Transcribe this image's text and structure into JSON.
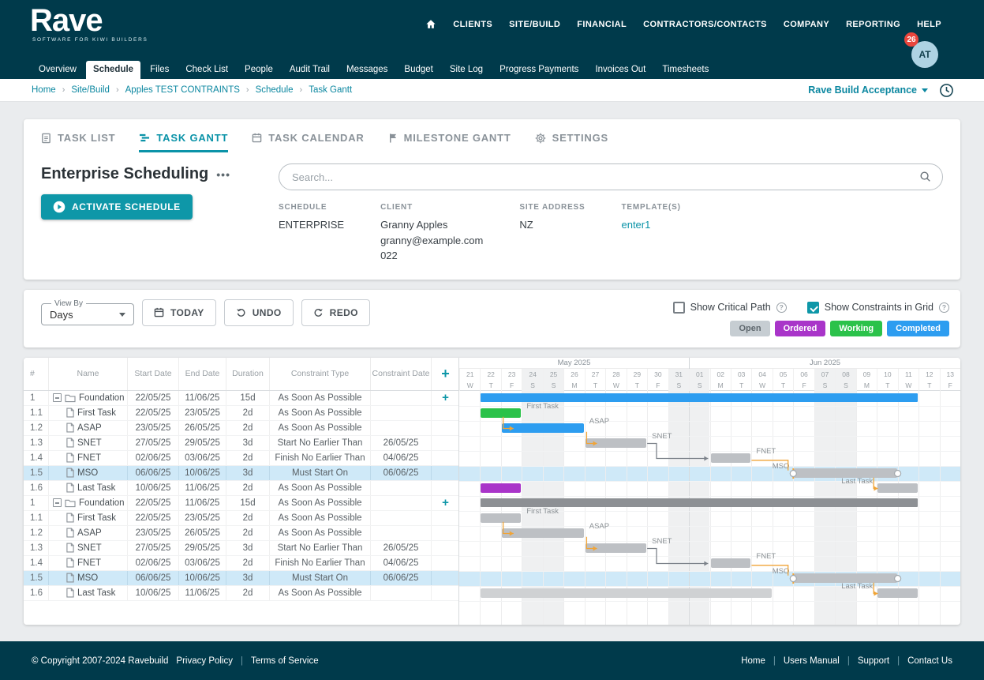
{
  "brand": {
    "name": "Rave",
    "tagline": "SOFTWARE FOR KIWI BUILDERS"
  },
  "topnav": {
    "items": [
      "CLIENTS",
      "SITE/BUILD",
      "FINANCIAL",
      "CONTRACTORS/CONTACTS",
      "COMPANY",
      "REPORTING",
      "HELP"
    ],
    "active": "SITE/BUILD",
    "badge": "26",
    "avatar": "AT"
  },
  "subnav": {
    "items": [
      "Overview",
      "Schedule",
      "Files",
      "Check List",
      "People",
      "Audit Trail",
      "Messages",
      "Budget",
      "Site Log",
      "Progress Payments",
      "Invoices Out",
      "Timesheets"
    ],
    "active": "Schedule"
  },
  "breadcrumb": {
    "items": [
      "Home",
      "Site/Build",
      "Apples TEST CONTRAINTS",
      "Schedule",
      "Task Gantt"
    ],
    "env": "Rave Build Acceptance"
  },
  "view_tabs": [
    {
      "label": "TASK LIST",
      "icon": "doc"
    },
    {
      "label": "TASK GANTT",
      "icon": "gantt",
      "active": true
    },
    {
      "label": "TASK CALENDAR",
      "icon": "calendar"
    },
    {
      "label": "MILESTONE GANTT",
      "icon": "flag"
    },
    {
      "label": "SETTINGS",
      "icon": "gear"
    }
  ],
  "schedule": {
    "title": "Enterprise Scheduling",
    "activate_label": "ACTIVATE SCHEDULE",
    "search_placeholder": "Search...",
    "meta": [
      {
        "label": "SCHEDULE",
        "lines": [
          "ENTERPRISE"
        ]
      },
      {
        "label": "CLIENT",
        "lines": [
          "Granny Apples",
          "granny@example.com",
          "022"
        ]
      },
      {
        "label": "SITE ADDRESS",
        "lines": [
          "NZ"
        ]
      },
      {
        "label": "TEMPLATE(S)",
        "lines": [
          "enter1"
        ],
        "link": true
      }
    ]
  },
  "toolbar": {
    "view_by_label": "View By",
    "view_by_value": "Days",
    "buttons": [
      {
        "label": "TODAY",
        "icon": "calendar"
      },
      {
        "label": "UNDO",
        "icon": "undo"
      },
      {
        "label": "REDO",
        "icon": "redo"
      }
    ],
    "checkboxes": [
      {
        "label": "Show Critical Path",
        "checked": false
      },
      {
        "label": "Show Constraints in Grid",
        "checked": true
      }
    ],
    "legend": [
      {
        "label": "Open",
        "color": "#c6cdd2"
      },
      {
        "label": "Ordered",
        "color": "#a935c9"
      },
      {
        "label": "Working",
        "color": "#2bc24a"
      },
      {
        "label": "Completed",
        "color": "#2d9df0"
      }
    ]
  },
  "grid": {
    "columns": [
      "#",
      "Name",
      "Start Date",
      "End Date",
      "Duration",
      "Constraint Type",
      "Constraint Date"
    ],
    "rows": [
      {
        "num": "1",
        "name": "Foundation",
        "group": true,
        "start": "22/05/25",
        "end": "11/06/25",
        "dur": "15d",
        "ctype": "As Soon As Possible",
        "cdate": "",
        "add": true
      },
      {
        "num": "1.1",
        "name": "First Task",
        "start": "22/05/25",
        "end": "23/05/25",
        "dur": "2d",
        "ctype": "As Soon As Possible",
        "cdate": ""
      },
      {
        "num": "1.2",
        "name": "ASAP",
        "start": "23/05/25",
        "end": "26/05/25",
        "dur": "2d",
        "ctype": "As Soon As Possible",
        "cdate": ""
      },
      {
        "num": "1.3",
        "name": "SNET",
        "start": "27/05/25",
        "end": "29/05/25",
        "dur": "3d",
        "ctype": "Start No Earlier Than",
        "cdate": "26/05/25"
      },
      {
        "num": "1.4",
        "name": "FNET",
        "start": "02/06/25",
        "end": "03/06/25",
        "dur": "2d",
        "ctype": "Finish No Earlier Than",
        "cdate": "04/06/25"
      },
      {
        "num": "1.5",
        "name": "MSO",
        "start": "06/06/25",
        "end": "10/06/25",
        "dur": "3d",
        "ctype": "Must Start On",
        "cdate": "06/06/25",
        "selected": true
      },
      {
        "num": "1.6",
        "name": "Last Task",
        "start": "10/06/25",
        "end": "11/06/25",
        "dur": "2d",
        "ctype": "As Soon As Possible",
        "cdate": ""
      },
      {
        "num": "1",
        "name": "Foundation",
        "group": true,
        "start": "22/05/25",
        "end": "11/06/25",
        "dur": "15d",
        "ctype": "As Soon As Possible",
        "cdate": "",
        "add": true
      },
      {
        "num": "1.1",
        "name": "First Task",
        "start": "22/05/25",
        "end": "23/05/25",
        "dur": "2d",
        "ctype": "As Soon As Possible",
        "cdate": ""
      },
      {
        "num": "1.2",
        "name": "ASAP",
        "start": "23/05/25",
        "end": "26/05/25",
        "dur": "2d",
        "ctype": "As Soon As Possible",
        "cdate": ""
      },
      {
        "num": "1.3",
        "name": "SNET",
        "start": "27/05/25",
        "end": "29/05/25",
        "dur": "3d",
        "ctype": "Start No Earlier Than",
        "cdate": "26/05/25"
      },
      {
        "num": "1.4",
        "name": "FNET",
        "start": "02/06/25",
        "end": "03/06/25",
        "dur": "2d",
        "ctype": "Finish No Earlier Than",
        "cdate": "04/06/25"
      },
      {
        "num": "1.5",
        "name": "MSO",
        "start": "06/06/25",
        "end": "10/06/25",
        "dur": "3d",
        "ctype": "Must Start On",
        "cdate": "06/06/25",
        "selected": true
      },
      {
        "num": "1.6",
        "name": "Last Task",
        "start": "10/06/25",
        "end": "11/06/25",
        "dur": "2d",
        "ctype": "As Soon As Possible",
        "cdate": ""
      }
    ]
  },
  "timeline": {
    "months": [
      {
        "label": "May 2025",
        "days": 11
      },
      {
        "label": "Jun 2025",
        "days": 13
      }
    ],
    "days": [
      [
        "21",
        "W"
      ],
      [
        "22",
        "T"
      ],
      [
        "23",
        "F"
      ],
      [
        "24",
        "S"
      ],
      [
        "25",
        "S"
      ],
      [
        "26",
        "M"
      ],
      [
        "27",
        "T"
      ],
      [
        "28",
        "W"
      ],
      [
        "29",
        "T"
      ],
      [
        "30",
        "F"
      ],
      [
        "31",
        "S"
      ],
      [
        "01",
        "S"
      ],
      [
        "02",
        "M"
      ],
      [
        "03",
        "T"
      ],
      [
        "04",
        "W"
      ],
      [
        "05",
        "T"
      ],
      [
        "06",
        "F"
      ],
      [
        "07",
        "S"
      ],
      [
        "08",
        "S"
      ],
      [
        "09",
        "M"
      ],
      [
        "10",
        "T"
      ],
      [
        "11",
        "W"
      ],
      [
        "12",
        "T"
      ],
      [
        "13",
        "F"
      ]
    ],
    "weekends": [
      3,
      4,
      10,
      11,
      17,
      18
    ]
  },
  "bars": [
    {
      "row": 0,
      "start": 1,
      "len": 21,
      "status": "completed",
      "summary": true
    },
    {
      "row": 1,
      "start": 1,
      "len": 2,
      "status": "working"
    },
    {
      "row": 2,
      "start": 2,
      "len": 4,
      "status": "completed"
    },
    {
      "row": 3,
      "start": 6,
      "len": 3,
      "status": "open"
    },
    {
      "row": 4,
      "start": 12,
      "len": 2,
      "status": "open"
    },
    {
      "row": 5,
      "start": 16,
      "len": 5,
      "status": "open",
      "handles": true,
      "constraint": true
    },
    {
      "row": 6,
      "start": 1,
      "len": 2,
      "status": "ordered"
    },
    {
      "row": 6,
      "start": 20,
      "len": 2,
      "status": "open"
    },
    {
      "row": 7,
      "start": 1,
      "len": 21,
      "status": "parent_open",
      "summary": true
    },
    {
      "row": 8,
      "start": 1,
      "len": 2,
      "status": "open"
    },
    {
      "row": 9,
      "start": 2,
      "len": 4,
      "status": "open"
    },
    {
      "row": 10,
      "start": 6,
      "len": 3,
      "status": "open"
    },
    {
      "row": 11,
      "start": 12,
      "len": 2,
      "status": "open"
    },
    {
      "row": 12,
      "start": 16,
      "len": 5,
      "status": "open",
      "handles": true,
      "constraint": true
    },
    {
      "row": 13,
      "start": 1,
      "len": 14,
      "status": "ghost"
    },
    {
      "row": 13,
      "start": 20,
      "len": 2,
      "status": "open"
    }
  ],
  "bar_labels": [
    {
      "row": 1,
      "day": 3,
      "text": "First Task",
      "side": "right"
    },
    {
      "row": 2,
      "day": 6,
      "text": "ASAP",
      "side": "right"
    },
    {
      "row": 3,
      "day": 9,
      "text": "SNET",
      "side": "right"
    },
    {
      "row": 4,
      "day": 14,
      "text": "FNET",
      "side": "right"
    },
    {
      "row": 5,
      "day": 16,
      "text": "MSO",
      "side": "left"
    },
    {
      "row": 6,
      "day": 20,
      "text": "Last Task",
      "side": "left"
    },
    {
      "row": 8,
      "day": 3,
      "text": "First Task",
      "side": "right"
    },
    {
      "row": 9,
      "day": 6,
      "text": "ASAP",
      "side": "right"
    },
    {
      "row": 10,
      "day": 9,
      "text": "SNET",
      "side": "right"
    },
    {
      "row": 11,
      "day": 14,
      "text": "FNET",
      "side": "right"
    },
    {
      "row": 12,
      "day": 16,
      "text": "MSO",
      "side": "left"
    },
    {
      "row": 13,
      "day": 20,
      "text": "Last Task",
      "side": "left"
    }
  ],
  "connectors": [
    {
      "c": "o",
      "pts": [
        [
          2.1,
          1.72
        ],
        [
          2.1,
          2.5
        ],
        [
          2.6,
          2.5
        ]
      ],
      "arrow": 1
    },
    {
      "c": "o",
      "pts": [
        [
          6.1,
          2.72
        ],
        [
          6.1,
          3.5
        ],
        [
          6.6,
          3.5
        ]
      ],
      "arrow": 1
    },
    {
      "c": "g",
      "pts": [
        [
          9,
          3.5
        ],
        [
          9.45,
          3.5
        ],
        [
          9.45,
          4.5
        ],
        [
          11.92,
          4.5
        ]
      ],
      "arrow": 1
    },
    {
      "c": "o",
      "pts": [
        [
          14,
          4.62
        ],
        [
          15.75,
          4.62
        ],
        [
          15.75,
          5.3
        ]
      ],
      "arrow": 0
    },
    {
      "c": "o",
      "pts": [
        [
          19.85,
          5.78
        ],
        [
          19.85,
          6.5
        ],
        [
          20.05,
          6.5
        ]
      ],
      "arrow": 1
    },
    {
      "c": "o",
      "pts": [
        [
          2.1,
          8.72
        ],
        [
          2.1,
          9.5
        ],
        [
          2.6,
          9.5
        ]
      ],
      "arrow": 1
    },
    {
      "c": "o",
      "pts": [
        [
          6.1,
          9.72
        ],
        [
          6.1,
          10.5
        ],
        [
          6.6,
          10.5
        ]
      ],
      "arrow": 1
    },
    {
      "c": "g",
      "pts": [
        [
          9,
          10.5
        ],
        [
          9.45,
          10.5
        ],
        [
          9.45,
          11.5
        ],
        [
          11.92,
          11.5
        ]
      ],
      "arrow": 1
    },
    {
      "c": "o",
      "pts": [
        [
          14,
          11.62
        ],
        [
          15.75,
          11.62
        ],
        [
          15.75,
          12.3
        ]
      ],
      "arrow": 0
    },
    {
      "c": "o",
      "pts": [
        [
          19.85,
          12.78
        ],
        [
          19.85,
          13.5
        ],
        [
          20.05,
          13.5
        ]
      ],
      "arrow": 1
    }
  ],
  "colors": {
    "accent": "#0e97a8",
    "completed": "#2d9df0",
    "working": "#2bc24a",
    "ordered": "#a935c9",
    "open": "#bdc0c4",
    "parent_open": "#8d9094",
    "ghost": "#cfd1d3",
    "selected_row": "#cfe9f8",
    "link": "#f0a437",
    "link_gray": "#7c828a"
  },
  "footer": {
    "copyright": "© Copyright 2007-2024 Ravebuild",
    "links_left": [
      "Privacy Policy",
      "Terms of Service"
    ],
    "links_right": [
      "Home",
      "Users Manual",
      "Support",
      "Contact Us"
    ]
  }
}
